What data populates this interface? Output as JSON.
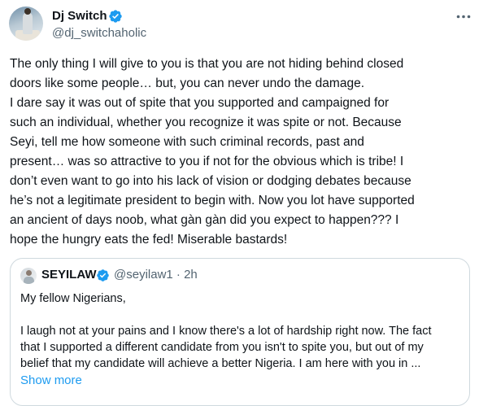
{
  "author": {
    "display_name": "Dj Switch",
    "handle": "@dj_switchaholic",
    "verified_icon": "verified-badge-icon",
    "more_icon": "more-options-icon"
  },
  "tweet": {
    "text": "The only thing I will give to you is that you are not hiding behind closed\ndoors like some people… but, you can never undo the damage.\nI dare say it was out of spite that you supported and campaigned for\nsuch an individual, whether you recognize it was spite or not. Because\nSeyi, tell me how someone with such criminal records, past and\npresent… was so attractive to you if not for the obvious which is tribe! I\ndon’t even want to go into his lack of vision or dodging debates because\nhe’s not a legitimate president to begin with. Now you lot have supported\nan ancient of days noob, what gàn gàn did you expect to happen??? I\nhope the hungry eats the fed! Miserable bastards!"
  },
  "quoted": {
    "display_name": "SEYILAW",
    "handle_time": "@seyilaw1 · 2h",
    "text": "My fellow Nigerians,\n\nI laugh not at your pains and I know there's a lot of hardship right now. The fact\nthat I supported a different candidate from you isn't to spite you, but out of my\nbelief that my candidate will achieve a better Nigeria. I am here with you in ...",
    "show_more": "Show more"
  },
  "colors": {
    "text": "#0f1419",
    "secondary": "#536471",
    "link": "#1d9bf0",
    "verified": "#1d9bf0",
    "border": "#cfd9de"
  }
}
